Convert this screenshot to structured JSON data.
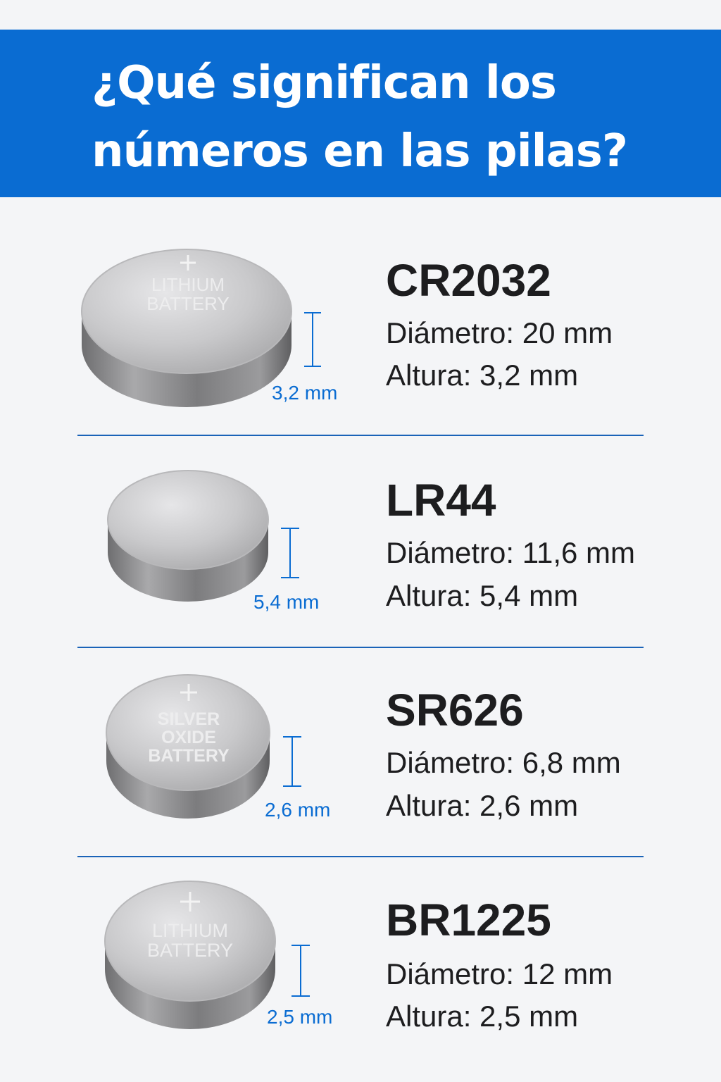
{
  "header": {
    "title_line1": "¿Qué significan los",
    "title_line2": "números en las pilas?"
  },
  "colors": {
    "header_bg": "#0a6cd2",
    "accent_blue": "#0a6cd2",
    "text_dark": "#1d1d1f",
    "page_bg": "#f4f5f7"
  },
  "batteries": [
    {
      "code": "CR2032",
      "diameter": "Diámetro: 20 mm",
      "height": "Altura: 3,2 mm",
      "height_label": "3,2 mm",
      "face_text": [
        "LITHIUM",
        "BATTERY"
      ]
    },
    {
      "code": "LR44",
      "diameter": "Diámetro: 11,6 mm",
      "height": "Altura: 5,4 mm",
      "height_label": "5,4 mm",
      "face_text": []
    },
    {
      "code": "SR626",
      "diameter": "Diámetro: 6,8 mm",
      "height": "Altura: 2,6 mm",
      "height_label": "2,6 mm",
      "face_text": [
        "SILVER",
        "OXIDE",
        "BATTERY"
      ]
    },
    {
      "code": "BR1225",
      "diameter": "Diámetro: 12 mm",
      "height": "Altura: 2,5 mm",
      "height_label": "2,5 mm",
      "face_text": [
        "LITHIUM",
        "BATTERY"
      ]
    }
  ]
}
